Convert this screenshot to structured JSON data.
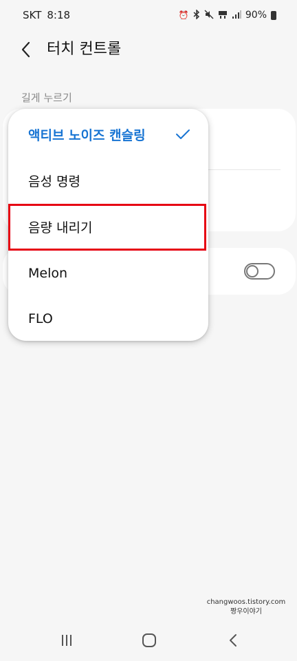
{
  "status_bar": {
    "carrier": "SKT",
    "time": "8:18",
    "battery_percent": "90%",
    "icons": [
      "alarm-icon",
      "bluetooth-icon",
      "mute-icon",
      "network-icon",
      "signal-icon",
      "battery-icon"
    ]
  },
  "header": {
    "title": "터치 컨트롤",
    "back_icon": "chevron-left-icon"
  },
  "section": {
    "label": "길게 누르기"
  },
  "popup": {
    "items": [
      {
        "label": "액티브 노이즈 캔슬링",
        "selected": true
      },
      {
        "label": "음성 명령",
        "selected": false
      },
      {
        "label": "음량 내리기",
        "selected": false
      },
      {
        "label": "Melon",
        "selected": false
      },
      {
        "label": "FLO",
        "selected": false
      }
    ]
  },
  "toggle": {
    "on": false
  },
  "watermark": {
    "line1": "changwoos.tistory.com",
    "line2": "짱우이야기"
  },
  "colors": {
    "accent": "#1774d3",
    "highlight": "#e60012",
    "background": "#f6f6f6",
    "card": "#ffffff"
  },
  "nav_bar": {
    "icons": [
      "recent-apps-icon",
      "home-icon",
      "back-icon"
    ]
  }
}
